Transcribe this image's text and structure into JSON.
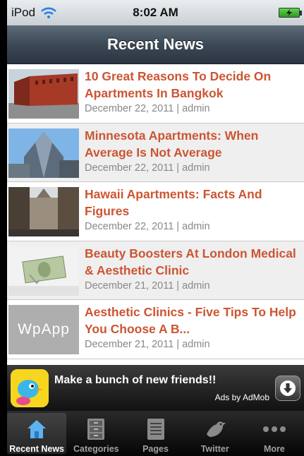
{
  "status_bar": {
    "carrier": "iPod",
    "time": "8:02 AM"
  },
  "nav": {
    "title": "Recent News"
  },
  "articles": [
    {
      "title": "10 Great Reasons To Decide On Apartments In Bangkok",
      "meta": "December 22, 2011 | admin"
    },
    {
      "title": "Minnesota Apartments: When Average Is Not Average",
      "meta": "December 22, 2011 | admin"
    },
    {
      "title": "Hawaii Apartments: Facts And Figures",
      "meta": "December 22, 2011 | admin"
    },
    {
      "title": "Beauty Boosters At London Medical & Aesthetic Clinic",
      "meta": "December 21, 2011 | admin"
    },
    {
      "title": "Aesthetic Clinics - Five Tips To Help You Choose A B...",
      "meta": "December 21, 2011 | admin",
      "thumb_text": "WpApp"
    }
  ],
  "ad": {
    "headline": "Make a bunch of new friends!!",
    "sub": "Ads by AdMob"
  },
  "tabs": [
    {
      "label": "Recent News",
      "icon": "home-icon",
      "active": true
    },
    {
      "label": "Categories",
      "icon": "cabinet-icon"
    },
    {
      "label": "Pages",
      "icon": "document-icon"
    },
    {
      "label": "Twitter",
      "icon": "bird-icon"
    },
    {
      "label": "More",
      "icon": "more-icon"
    }
  ],
  "colors": {
    "title": "#cc5533",
    "meta": "#888888",
    "nav_bg": "#3c4956"
  }
}
